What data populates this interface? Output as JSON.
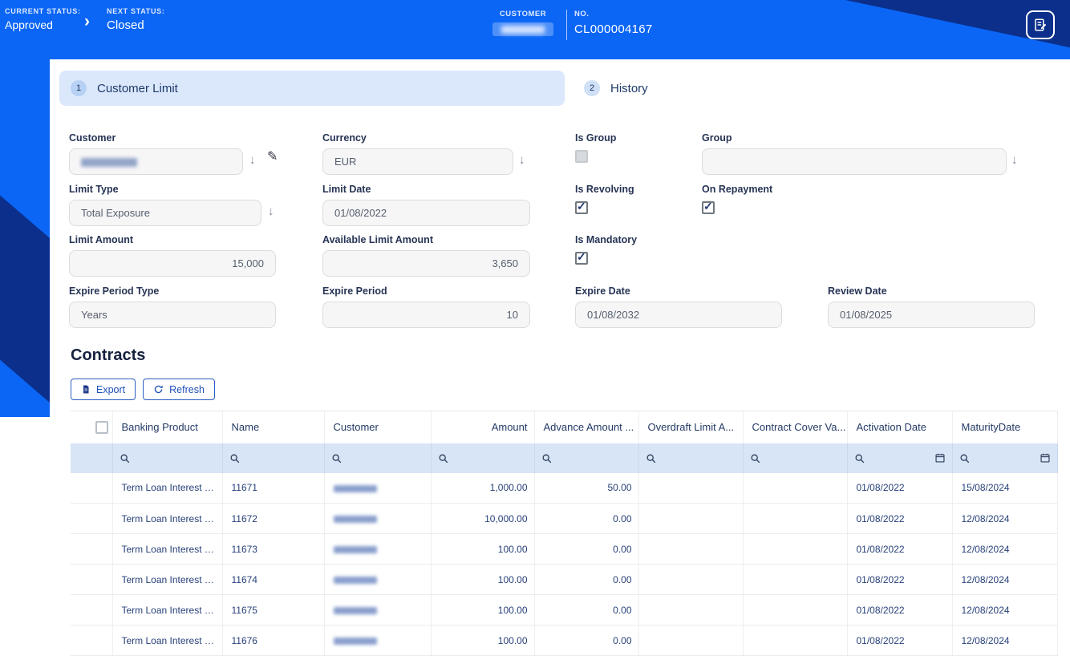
{
  "colors": {
    "primary_blue": "#0b66f6",
    "decor_navy": "#0b2f8a",
    "step_pill_bg": "#dbe8fc",
    "filter_row_bg": "#d8e5f6",
    "link_blue": "#1e4fb8"
  },
  "icons": {
    "dropdown_arrow": "↓",
    "edit_pencil": "✎",
    "chevron_right": "›"
  },
  "header": {
    "current_status_label": "CURRENT STATUS:",
    "current_status_value": "Approved",
    "next_status_label": "NEXT STATUS:",
    "next_status_value": "Closed",
    "customer_label": "CUSTOMER",
    "no_label": "NO.",
    "no_value": "CL000004167"
  },
  "steps": [
    {
      "number": "1",
      "label": "Customer Limit"
    },
    {
      "number": "2",
      "label": "History"
    }
  ],
  "form": {
    "customer": {
      "label": "Customer",
      "value": ""
    },
    "currency": {
      "label": "Currency",
      "value": "EUR"
    },
    "is_group": {
      "label": "Is Group",
      "checked": false
    },
    "group": {
      "label": "Group",
      "value": ""
    },
    "limit_type": {
      "label": "Limit Type",
      "value": "Total Exposure"
    },
    "limit_date": {
      "label": "Limit Date",
      "value": "01/08/2022"
    },
    "is_revolving": {
      "label": "Is Revolving",
      "checked": true
    },
    "on_repayment": {
      "label": "On Repayment",
      "checked": true
    },
    "limit_amount": {
      "label": "Limit Amount",
      "value": "15,000"
    },
    "available_limit_amount": {
      "label": "Available Limit Amount",
      "value": "3,650"
    },
    "is_mandatory": {
      "label": "Is Mandatory",
      "checked": true
    },
    "expire_period_type": {
      "label": "Expire Period Type",
      "value": "Years"
    },
    "expire_period": {
      "label": "Expire Period",
      "value": "10"
    },
    "expire_date": {
      "label": "Expire Date",
      "value": "01/08/2032"
    },
    "review_date": {
      "label": "Review Date",
      "value": "01/08/2025"
    }
  },
  "contracts": {
    "title": "Contracts",
    "export_label": "Export",
    "refresh_label": "Refresh",
    "columns": [
      "Banking Product",
      "Name",
      "Customer",
      "Amount",
      "Advance Amount ...",
      "Overdraft Limit A...",
      "Contract Cover Va...",
      "Activation Date",
      "MaturityDate"
    ],
    "rows": [
      {
        "banking_product": "Term Loan Interest C...",
        "name": "11671",
        "customer": "",
        "amount": "1,000.00",
        "advance_amount": "50.00",
        "overdraft_limit": "",
        "contract_cover": "",
        "activation_date": "01/08/2022",
        "maturity_date": "15/08/2024"
      },
      {
        "banking_product": "Term Loan Interest C...",
        "name": "11672",
        "customer": "",
        "amount": "10,000.00",
        "advance_amount": "0.00",
        "overdraft_limit": "",
        "contract_cover": "",
        "activation_date": "01/08/2022",
        "maturity_date": "12/08/2024"
      },
      {
        "banking_product": "Term Loan Interest C...",
        "name": "11673",
        "customer": "",
        "amount": "100.00",
        "advance_amount": "0.00",
        "overdraft_limit": "",
        "contract_cover": "",
        "activation_date": "01/08/2022",
        "maturity_date": "12/08/2024"
      },
      {
        "banking_product": "Term Loan Interest C...",
        "name": "11674",
        "customer": "",
        "amount": "100.00",
        "advance_amount": "0.00",
        "overdraft_limit": "",
        "contract_cover": "",
        "activation_date": "01/08/2022",
        "maturity_date": "12/08/2024"
      },
      {
        "banking_product": "Term Loan Interest C...",
        "name": "11675",
        "customer": "",
        "amount": "100.00",
        "advance_amount": "0.00",
        "overdraft_limit": "",
        "contract_cover": "",
        "activation_date": "01/08/2022",
        "maturity_date": "12/08/2024"
      },
      {
        "banking_product": "Term Loan Interest C...",
        "name": "11676",
        "customer": "",
        "amount": "100.00",
        "advance_amount": "0.00",
        "overdraft_limit": "",
        "contract_cover": "",
        "activation_date": "01/08/2022",
        "maturity_date": "12/08/2024"
      }
    ]
  }
}
